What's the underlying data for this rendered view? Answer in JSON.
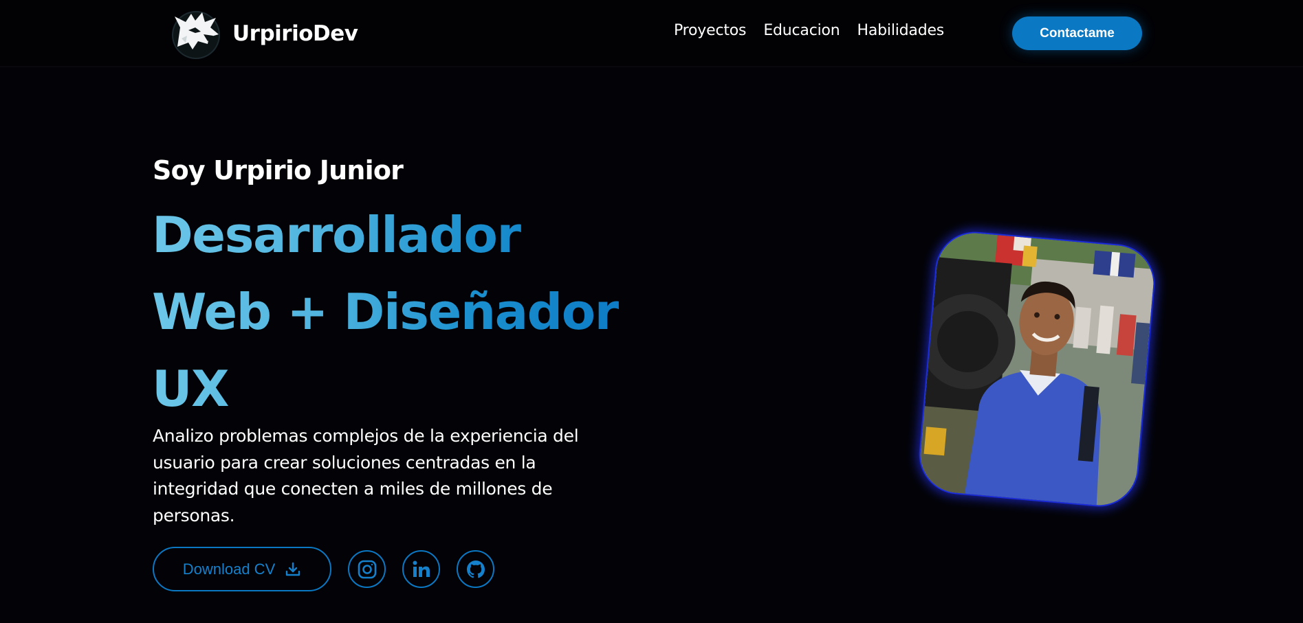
{
  "brand": {
    "name": "UrpirioDev",
    "logo_icon": "wolf-logo-icon"
  },
  "nav": {
    "links": [
      "Proyectos",
      "Educacion",
      "Habilidades"
    ],
    "contact_label": "Contactame"
  },
  "hero": {
    "intro": "Soy Urpirio Junior",
    "title": "Desarrollador Web + Diseñador UX",
    "description": "Analizo problemas complejos de la experiencia del usuario para crear soluciones centradas en la integridad que conecten a miles de millones de personas.",
    "cv_label": "Download CV",
    "cv_icon": "download-icon",
    "social_icons": [
      "instagram-icon",
      "linkedin-icon",
      "github-icon"
    ],
    "photo": "profile-photo"
  },
  "colors": {
    "background": "#030307",
    "accent": "#0b78c4",
    "gradient_start": "#6cc6e8",
    "photo_glow": "#1a2bd8"
  }
}
